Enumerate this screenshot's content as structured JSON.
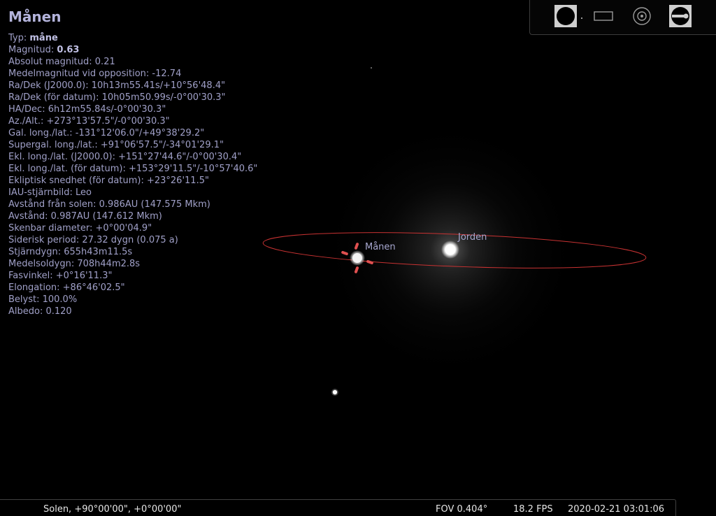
{
  "object": {
    "title": "Månen",
    "type_label": "Typ:",
    "type_value": "måne",
    "magnitude_label": "Magnitud:",
    "magnitude_value": "0.63",
    "rows": [
      "Absolut magnitud: 0.21",
      "Medelmagnitud vid opposition: -12.74",
      "Ra/Dek (J2000.0): 10h13m55.41s/+10°56'48.4\"",
      "Ra/Dek (för datum): 10h05m50.99s/-0°00'30.3\"",
      "HA/Dec: 6h12m55.84s/-0°00'30.3\"",
      "Az./Alt.: +273°13'57.5\"/-0°00'30.3\"",
      "Gal. long./lat.: -131°12'06.0\"/+49°38'29.2\"",
      "Supergal. long./lat.: +91°06'57.5\"/-34°01'29.1\"",
      "Ekl. long./lat. (J2000.0): +151°27'44.6\"/-0°00'30.4\"",
      "Ekl. long./lat. (för datum): +153°29'11.5\"/-10°57'40.6\"",
      "Ekliptisk snedhet (för datum): +23°26'11.5\"",
      "IAU-stjärnbild: Leo",
      "Avstånd från solen: 0.986AU (147.575 Mkm)",
      "Avstånd: 0.987AU (147.612 Mkm)",
      "Skenbar diameter: +0°00'04.9\"",
      "Siderisk period: 27.32 dygn (0.075 a)",
      "Stjärndygn: 655h43m11.5s",
      "Medelsoldygn: 708h44m2.8s",
      "Fasvinkel: +0°16'11.3\"",
      "Elongation: +86°46'02.5\"",
      "Belyst: 100.0%",
      "Albedo: 0.120"
    ]
  },
  "sky": {
    "moon_label": "Månen",
    "earth_label": "Jorden",
    "orbit_color": "#c83232",
    "marker_color": "#e05050"
  },
  "toolbar": {
    "buttons": [
      {
        "name": "planet-view-icon",
        "active": true
      },
      {
        "name": "rectangle-icon",
        "active": false
      },
      {
        "name": "target-icon",
        "active": false
      },
      {
        "name": "telescope-icon",
        "active": true
      }
    ]
  },
  "statusbar": {
    "location": "Solen, +90°00'00\", +0°00'00\"",
    "fov": "FOV 0.404°",
    "fps": "18.2 FPS",
    "datetime": "2020-02-21 03:01:06"
  }
}
